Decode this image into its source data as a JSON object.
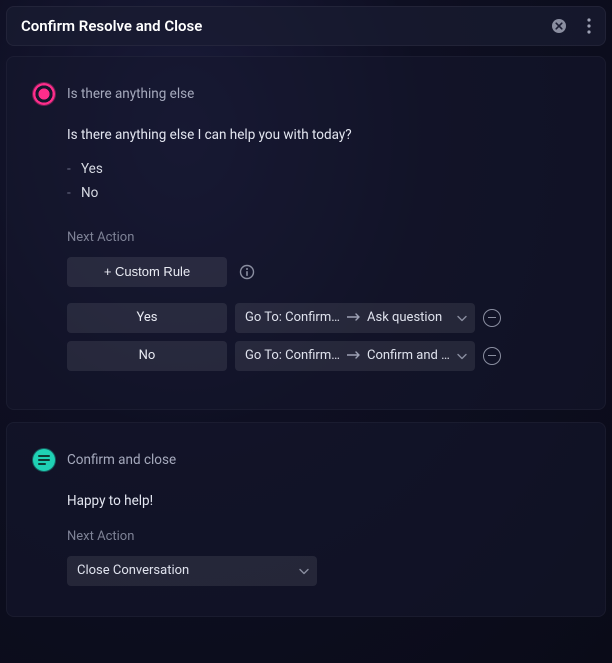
{
  "header": {
    "title": "Confirm Resolve and Close"
  },
  "node1": {
    "title": "Is there anything else",
    "prompt": "Is there anything else I can help you with today?",
    "choices": [
      "Yes",
      "No"
    ],
    "next_action_label": "Next Action",
    "custom_rule_label": "+ Custom Rule",
    "rows": [
      {
        "answer": "Yes",
        "goto_prefix": "Go To: Confirm Resolve and Close",
        "goto_target": "Ask question"
      },
      {
        "answer": "No",
        "goto_prefix": "Go To: Confirm Resolve and Close",
        "goto_target": "Confirm and close"
      }
    ]
  },
  "node2": {
    "title": "Confirm and close",
    "prompt": "Happy to help!",
    "next_action_label": "Next Action",
    "close_action": "Close Conversation"
  }
}
